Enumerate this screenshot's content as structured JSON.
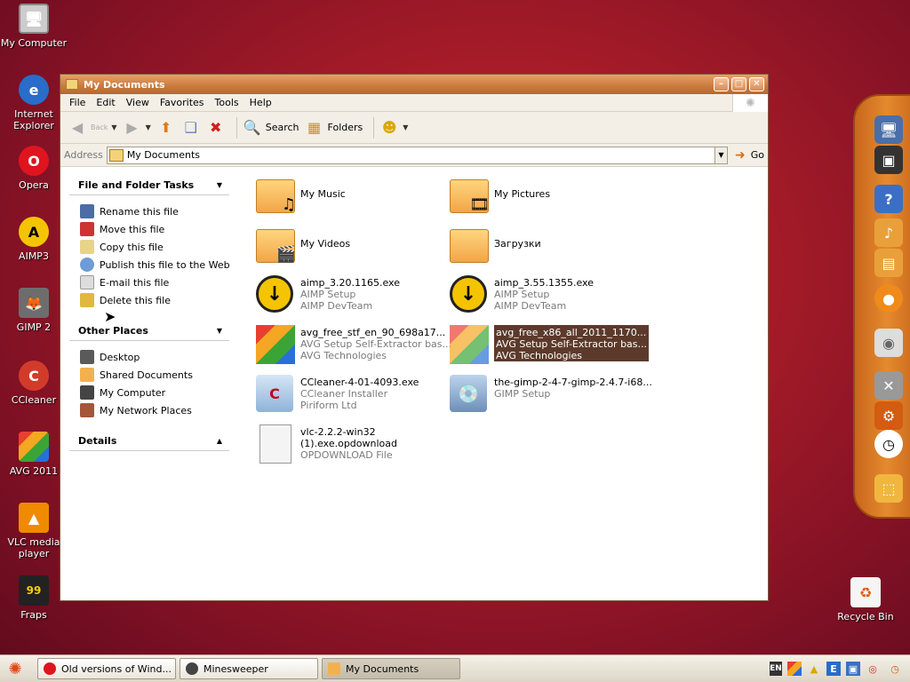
{
  "desktop": {
    "icons": [
      {
        "label": "My Computer"
      },
      {
        "label": "Internet Explorer"
      },
      {
        "label": "Opera"
      },
      {
        "label": "AIMP3"
      },
      {
        "label": "GIMP 2"
      },
      {
        "label": "CCleaner"
      },
      {
        "label": "AVG 2011"
      },
      {
        "label": "VLC media player"
      },
      {
        "label": "Fraps"
      },
      {
        "label": "Recycle Bin"
      }
    ]
  },
  "window": {
    "title": "My Documents",
    "menu": [
      "File",
      "Edit",
      "View",
      "Favorites",
      "Tools",
      "Help"
    ],
    "toolbar": {
      "back": "Back",
      "search": "Search",
      "folders": "Folders"
    },
    "address": {
      "label": "Address",
      "value": "My Documents",
      "go": "Go"
    },
    "tasks": {
      "file_folder": {
        "title": "File and Folder Tasks",
        "items": [
          "Rename this file",
          "Move this file",
          "Copy this file",
          "Publish this file to the Web",
          "E-mail this file",
          "Delete this file"
        ]
      },
      "other_places": {
        "title": "Other Places",
        "items": [
          "Desktop",
          "Shared Documents",
          "My Computer",
          "My Network Places"
        ]
      },
      "details": {
        "title": "Details"
      }
    },
    "files": [
      {
        "name": "My Music",
        "l2": "",
        "l3": ""
      },
      {
        "name": "My Pictures",
        "l2": "",
        "l3": ""
      },
      {
        "name": "My Videos",
        "l2": "",
        "l3": ""
      },
      {
        "name": "Загрузки",
        "l2": "",
        "l3": ""
      },
      {
        "name": "aimp_3.20.1165.exe",
        "l2": "AIMP Setup",
        "l3": "AIMP DevTeam"
      },
      {
        "name": "aimp_3.55.1355.exe",
        "l2": "AIMP Setup",
        "l3": "AIMP DevTeam"
      },
      {
        "name": "avg_free_stf_en_90_698a17...",
        "l2": "AVG Setup Self-Extractor bas...",
        "l3": "AVG Technologies"
      },
      {
        "name": "avg_free_x86_all_2011_1170...",
        "l2": "AVG Setup Self-Extractor bas...",
        "l3": "AVG Technologies"
      },
      {
        "name": "CCleaner-4-01-4093.exe",
        "l2": "CCleaner Installer",
        "l3": "Piriform Ltd"
      },
      {
        "name": "the-gimp-2-4-7-gimp-2.4.7-i68...",
        "l2": "GIMP Setup",
        "l3": ""
      },
      {
        "name": "vlc-2.2.2-win32",
        "l2": "(1).exe.opdownload",
        "l3": "OPDOWNLOAD File"
      }
    ]
  },
  "taskbar": {
    "tasks": [
      "Old versions of Wind...",
      "Minesweeper",
      "My Documents"
    ],
    "tray_lang": "EN"
  },
  "colors": {
    "title_bar": "#c97a3e",
    "selection": "#5c3a2b",
    "desktop": "#a81c28"
  }
}
